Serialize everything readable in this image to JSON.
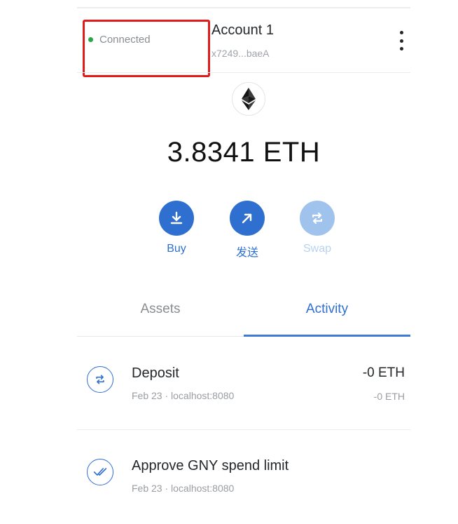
{
  "header": {
    "connection_status": "Connected",
    "account_name": "Account 1",
    "account_address": "x7249...baeA"
  },
  "balance": {
    "amount": "3.8341 ETH"
  },
  "actions": [
    {
      "label": "Buy",
      "icon": "download-icon",
      "enabled": true
    },
    {
      "label": "发送",
      "icon": "arrow-up-right-icon",
      "enabled": true
    },
    {
      "label": "Swap",
      "icon": "swap-icon",
      "enabled": false
    }
  ],
  "tabs": [
    {
      "label": "Assets",
      "active": false
    },
    {
      "label": "Activity",
      "active": true
    }
  ],
  "activity": [
    {
      "title": "Deposit",
      "subtitle": "Feb 23 · localhost:8080",
      "amount": "-0 ETH",
      "amount_secondary": "-0 ETH",
      "icon": "swap-icon"
    },
    {
      "title": "Approve GNY spend limit",
      "subtitle": "Feb 23 · localhost:8080",
      "amount": "",
      "amount_secondary": "",
      "icon": "approve-icon"
    }
  ],
  "colors": {
    "primary": "#2f6fd0",
    "primary_disabled": "#9fc3ec",
    "highlight_box": "#e01b1b",
    "connected_dot": "#28a745"
  }
}
